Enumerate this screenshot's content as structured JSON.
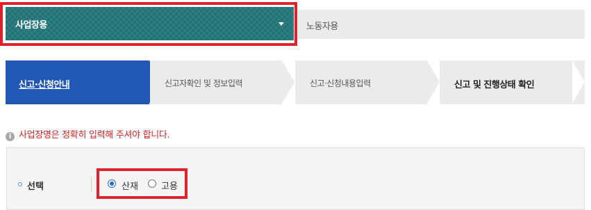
{
  "tabs": [
    {
      "label": "사업장용",
      "active": true
    },
    {
      "label": "노동자용",
      "active": false
    }
  ],
  "steps": [
    {
      "label": "신고·신청안내",
      "active": true
    },
    {
      "label": "신고자확인 및 정보입력"
    },
    {
      "label": "신고·신청내용입력"
    },
    {
      "label": "신고 및 진행상태 확인"
    }
  ],
  "notice": {
    "icon": "i",
    "text": "사업장명은 정확히 입력해 주셔야 합니다."
  },
  "form": {
    "field_label": "선택",
    "options": [
      {
        "label": "산재",
        "checked": true
      },
      {
        "label": "고용",
        "checked": false
      }
    ]
  },
  "colors": {
    "tab_active": "#2a7f82",
    "step_active": "#2158b5",
    "highlight": "#e0202a",
    "notice": "#d62020"
  }
}
